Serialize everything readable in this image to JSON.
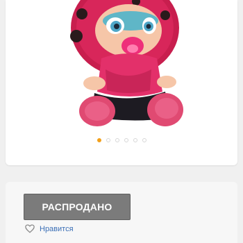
{
  "gallery": {
    "image_alt": "doll-photo",
    "slide_count": 6,
    "active_slide": 1,
    "accent_color": "#f2a01b"
  },
  "status": {
    "sold_label": "РАСПРОДАНО",
    "button_color": "#7b7b7b"
  },
  "like": {
    "label": "Нравится",
    "icon": "heart-outline-icon",
    "color": "#3b6fb6"
  }
}
